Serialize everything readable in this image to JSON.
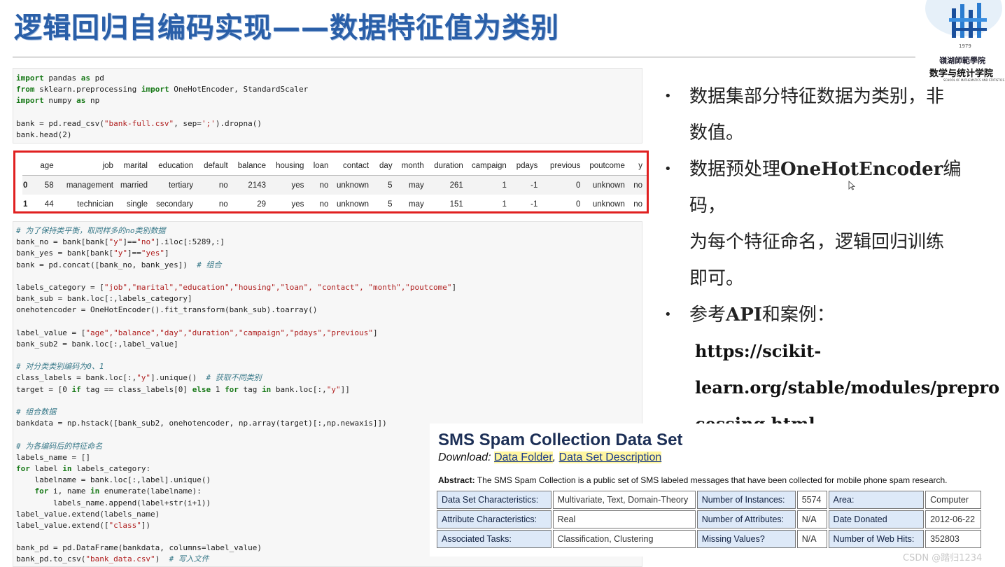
{
  "slide": {
    "title": "逻辑回归自编码实现——数据特征值为类别",
    "logo": {
      "year": "1979",
      "name_cn": "嶺湖師範學院",
      "dept_cn": "数学与统计学院",
      "dept_en": "SCHOOL OF MATHEMATICS AND STATISTICS"
    }
  },
  "code_cell_1": [
    [
      [
        "kw",
        "import"
      ],
      [
        "t",
        " pandas "
      ],
      [
        "kw",
        "as"
      ],
      [
        "t",
        " pd"
      ]
    ],
    [
      [
        "kw",
        "from"
      ],
      [
        "t",
        " sklearn.preprocessing "
      ],
      [
        "kw",
        "import"
      ],
      [
        "t",
        " OneHotEncoder, StandardScaler"
      ]
    ],
    [
      [
        "kw",
        "import"
      ],
      [
        "t",
        " numpy "
      ],
      [
        "kw",
        "as"
      ],
      [
        "t",
        " np"
      ]
    ],
    [
      [
        "t",
        ""
      ]
    ],
    [
      [
        "t",
        "bank = pd.read_csv("
      ],
      [
        "str",
        "\"bank-full.csv\""
      ],
      [
        "t",
        ", sep="
      ],
      [
        "str",
        "';'"
      ],
      [
        "t",
        ").dropna()"
      ]
    ],
    [
      [
        "t",
        "bank.head(2)"
      ]
    ]
  ],
  "dataframe": {
    "columns": [
      "",
      "age",
      "job",
      "marital",
      "education",
      "default",
      "balance",
      "housing",
      "loan",
      "contact",
      "day",
      "month",
      "duration",
      "campaign",
      "pdays",
      "previous",
      "poutcome",
      "y"
    ],
    "rows": [
      [
        "0",
        "58",
        "management",
        "married",
        "tertiary",
        "no",
        "2143",
        "yes",
        "no",
        "unknown",
        "5",
        "may",
        "261",
        "1",
        "-1",
        "0",
        "unknown",
        "no"
      ],
      [
        "1",
        "44",
        "technician",
        "single",
        "secondary",
        "no",
        "29",
        "yes",
        "no",
        "unknown",
        "5",
        "may",
        "151",
        "1",
        "-1",
        "0",
        "unknown",
        "no"
      ]
    ]
  },
  "code_cell_2": [
    [
      [
        "cm",
        "# 为了保持类平衡，取同样多的no类别数据"
      ]
    ],
    [
      [
        "t",
        "bank_no = bank[bank["
      ],
      [
        "str",
        "\"y\""
      ],
      [
        "t",
        "]=="
      ],
      [
        "str",
        "\"no\""
      ],
      [
        "t",
        "].iloc[:5289,:]"
      ]
    ],
    [
      [
        "t",
        "bank_yes = bank[bank["
      ],
      [
        "str",
        "\"y\""
      ],
      [
        "t",
        "]=="
      ],
      [
        "str",
        "\"yes\""
      ],
      [
        "t",
        "]"
      ]
    ],
    [
      [
        "t",
        "bank = pd.concat([bank_no, bank_yes])  "
      ],
      [
        "cm",
        "# 组合"
      ]
    ],
    [
      [
        "t",
        ""
      ]
    ],
    [
      [
        "t",
        "labels_category = ["
      ],
      [
        "str",
        "\"job\",\"marital\",\"education\",\"housing\",\"loan\", \"contact\", \"month\",\"poutcome\""
      ],
      [
        "t",
        "]"
      ]
    ],
    [
      [
        "t",
        "bank_sub = bank.loc[:,labels_category]"
      ]
    ],
    [
      [
        "t",
        "onehotencoder = OneHotEncoder().fit_transform(bank_sub).toarray()"
      ]
    ],
    [
      [
        "t",
        ""
      ]
    ],
    [
      [
        "t",
        "label_value = ["
      ],
      [
        "str",
        "\"age\",\"balance\",\"day\",\"duration\",\"campaign\",\"pdays\",\"previous\""
      ],
      [
        "t",
        "]"
      ]
    ],
    [
      [
        "t",
        "bank_sub2 = bank.loc[:,label_value]"
      ]
    ],
    [
      [
        "t",
        ""
      ]
    ],
    [
      [
        "cm",
        "# 对分类类别编码为0、1"
      ]
    ],
    [
      [
        "t",
        "class_labels = bank.loc[:,"
      ],
      [
        "str",
        "\"y\""
      ],
      [
        "t",
        "].unique()  "
      ],
      [
        "cm",
        "# 获取不同类别"
      ]
    ],
    [
      [
        "t",
        "target = [0 "
      ],
      [
        "kw",
        "if"
      ],
      [
        "t",
        " tag == class_labels[0] "
      ],
      [
        "kw",
        "else"
      ],
      [
        "t",
        " 1 "
      ],
      [
        "kw",
        "for"
      ],
      [
        "t",
        " tag "
      ],
      [
        "kw",
        "in"
      ],
      [
        "t",
        " bank.loc[:,"
      ],
      [
        "str",
        "\"y\""
      ],
      [
        "t",
        "]]"
      ]
    ],
    [
      [
        "t",
        ""
      ]
    ],
    [
      [
        "cm",
        "# 组合数据"
      ]
    ],
    [
      [
        "t",
        "bankdata = np.hstack([bank_sub2, onehotencoder, np.array(target)[:,np.newaxis]])"
      ]
    ],
    [
      [
        "t",
        ""
      ]
    ],
    [
      [
        "cm",
        "# 为各编码后的特征命名"
      ]
    ],
    [
      [
        "t",
        "labels_name = []"
      ]
    ],
    [
      [
        "kw",
        "for"
      ],
      [
        "t",
        " label "
      ],
      [
        "kw",
        "in"
      ],
      [
        "t",
        " labels_category:"
      ]
    ],
    [
      [
        "t",
        "    labelname = bank.loc[:,label].unique()"
      ]
    ],
    [
      [
        "t",
        "    "
      ],
      [
        "kw",
        "for"
      ],
      [
        "t",
        " i, name "
      ],
      [
        "kw",
        "in"
      ],
      [
        "t",
        " enumerate(labelname):"
      ]
    ],
    [
      [
        "t",
        "        labels_name.append(label+str(i+1))"
      ]
    ],
    [
      [
        "t",
        "label_value.extend(labels_name)"
      ]
    ],
    [
      [
        "t",
        "label_value.extend(["
      ],
      [
        "str",
        "\"class\""
      ],
      [
        "t",
        "])"
      ]
    ],
    [
      [
        "t",
        ""
      ]
    ],
    [
      [
        "t",
        "bank_pd = pd.DataFrame(bankdata, columns=label_value)"
      ]
    ],
    [
      [
        "t",
        "bank_pd.to_csv("
      ],
      [
        "str",
        "\"bank_data.csv\""
      ],
      [
        "t",
        ")  "
      ],
      [
        "cm",
        "# 写入文件"
      ]
    ]
  ],
  "bullets": {
    "b1": "数据集部分特征数据为类别，非数值。",
    "b1_l1": "数据集部分特征数据为类别，非",
    "b1_l2": "数值。",
    "b2_pre": "数据预处理",
    "b2_bold": "OneHotEncoder",
    "b2_post": "编码，",
    "b2_l2": "为每个特征命名，逻辑回归训练",
    "b2_l3": "即可。",
    "b3_pre": "参考",
    "b3_bold": "API",
    "b3_post": "和案例：",
    "url_l1": "https://scikit-",
    "url_l2": "learn.org/stable/modules/prepro",
    "url_l3": "cessing.html"
  },
  "uci": {
    "heading": "SMS Spam Collection Data Set",
    "download_label": "Download:",
    "link_folder": "Data Folder",
    "link_desc": "Data Set Description",
    "abstract_label": "Abstract:",
    "abstract_text": "The SMS Spam Collection is a public set of SMS labeled messages that have been collected for mobile phone spam research.",
    "table": [
      [
        "Data Set Characteristics:",
        "Multivariate, Text, Domain-Theory",
        "Number of Instances:",
        "5574",
        "Area:",
        "Computer"
      ],
      [
        "Attribute Characteristics:",
        "Real",
        "Number of Attributes:",
        "N/A",
        "Date Donated",
        "2012-06-22"
      ],
      [
        "Associated Tasks:",
        "Classification, Clustering",
        "Missing Values?",
        "N/A",
        "Number of Web Hits:",
        "352803"
      ]
    ]
  },
  "watermark": "CSDN @踏归1234",
  "colors": {
    "title": "#2a5fa8",
    "highlight_border": "#e02020",
    "keyword": "#1a7a1a",
    "string": "#b02020"
  }
}
